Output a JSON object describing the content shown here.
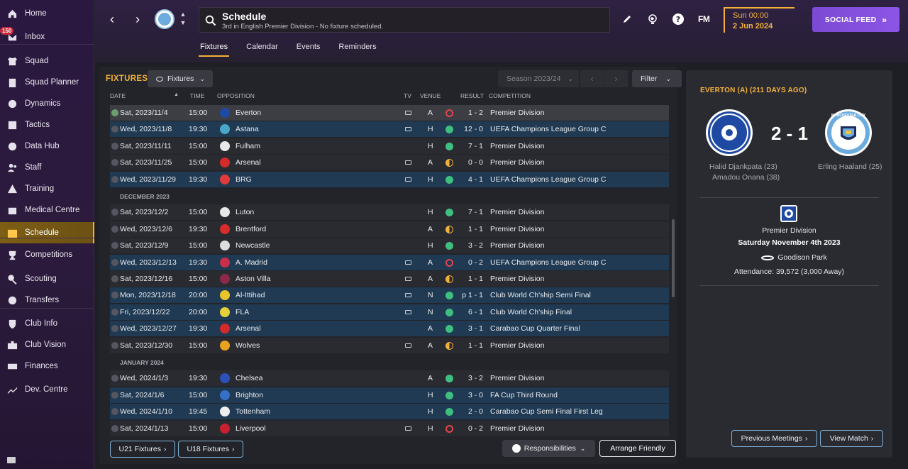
{
  "sidebar": {
    "inbox_badge": "150",
    "items": [
      {
        "label": "Home",
        "icon": "home-icon"
      },
      {
        "label": "Inbox",
        "icon": "inbox-icon"
      },
      {
        "label": "Squad",
        "icon": "shirt-icon"
      },
      {
        "label": "Squad Planner",
        "icon": "clipboard-icon"
      },
      {
        "label": "Dynamics",
        "icon": "dynamics-icon"
      },
      {
        "label": "Tactics",
        "icon": "tactics-icon"
      },
      {
        "label": "Data Hub",
        "icon": "data-hub-icon"
      },
      {
        "label": "Staff",
        "icon": "staff-icon"
      },
      {
        "label": "Training",
        "icon": "training-icon"
      },
      {
        "label": "Medical Centre",
        "icon": "medical-icon"
      },
      {
        "label": "Schedule",
        "icon": "calendar-icon"
      },
      {
        "label": "Competitions",
        "icon": "trophy-icon"
      },
      {
        "label": "Scouting",
        "icon": "magnifier-icon"
      },
      {
        "label": "Transfers",
        "icon": "transfer-icon"
      },
      {
        "label": "Club Info",
        "icon": "shield-icon"
      },
      {
        "label": "Club Vision",
        "icon": "briefcase-icon"
      },
      {
        "label": "Finances",
        "icon": "money-icon"
      },
      {
        "label": "Dev. Centre",
        "icon": "growth-icon"
      }
    ]
  },
  "header": {
    "title": "Schedule",
    "subtitle": "3rd in English Premier Division - No fixture scheduled.",
    "fm_logo": "FM",
    "date_time": "Sun 00:00",
    "date": "2 Jun 2024",
    "social_feed": "SOCIAL FEED",
    "tabs": [
      "Fixtures",
      "Calendar",
      "Events",
      "Reminders"
    ]
  },
  "fixtures": {
    "title": "FIXTURES",
    "view_dropdown": "Fixtures",
    "season": "Season 2023/24",
    "filter": "Filter",
    "columns": {
      "date": "DATE",
      "time": "TIME",
      "opposition": "OPPOSITION",
      "tv": "TV",
      "venue": "VENUE",
      "result": "RESULT",
      "competition": "COMPETITION"
    },
    "rows": [
      {
        "type": "row",
        "date": "Sat, 2023/11/4",
        "time": "15:00",
        "opp": "Everton",
        "tv": true,
        "venue": "A",
        "res": "l",
        "score": "1 - 2",
        "comp": "Premier Division",
        "style": "sel",
        "crest": "#1f4aa3",
        "done": true
      },
      {
        "type": "row",
        "date": "Wed, 2023/11/8",
        "time": "19:30",
        "opp": "Astana",
        "tv": true,
        "venue": "H",
        "res": "w",
        "score": "12 - 0",
        "comp": "UEFA Champions League Group C",
        "style": "b",
        "crest": "#4aa6c8"
      },
      {
        "type": "row",
        "date": "Sat, 2023/11/11",
        "time": "15:00",
        "opp": "Fulham",
        "tv": false,
        "venue": "H",
        "res": "w",
        "score": "7 - 1",
        "comp": "Premier Division",
        "style": "a",
        "crest": "#e8e8e8"
      },
      {
        "type": "row",
        "date": "Sat, 2023/11/25",
        "time": "15:00",
        "opp": "Arsenal",
        "tv": true,
        "venue": "A",
        "res": "d",
        "score": "0 - 0",
        "comp": "Premier Division",
        "style": "a",
        "crest": "#d42a2a"
      },
      {
        "type": "row",
        "date": "Wed, 2023/11/29",
        "time": "19:30",
        "opp": "BRG",
        "tv": true,
        "venue": "H",
        "res": "w",
        "score": "4 - 1",
        "comp": "UEFA Champions League Group C",
        "style": "b",
        "crest": "#e03a3a"
      },
      {
        "type": "month",
        "label": "DECEMBER 2023"
      },
      {
        "type": "row",
        "date": "Sat, 2023/12/2",
        "time": "15:00",
        "opp": "Luton",
        "tv": false,
        "venue": "H",
        "res": "w",
        "score": "7 - 1",
        "comp": "Premier Division",
        "style": "a",
        "crest": "#e8e8e8"
      },
      {
        "type": "row",
        "date": "Wed, 2023/12/6",
        "time": "19:30",
        "opp": "Brentford",
        "tv": false,
        "venue": "A",
        "res": "d",
        "score": "1 - 1",
        "comp": "Premier Division",
        "style": "a",
        "crest": "#d82b2b"
      },
      {
        "type": "row",
        "date": "Sat, 2023/12/9",
        "time": "15:00",
        "opp": "Newcastle",
        "tv": false,
        "venue": "H",
        "res": "w",
        "score": "3 - 2",
        "comp": "Premier Division",
        "style": "a",
        "crest": "#dddddd"
      },
      {
        "type": "row",
        "date": "Wed, 2023/12/13",
        "time": "19:30",
        "opp": "A. Madrid",
        "tv": true,
        "venue": "A",
        "res": "l",
        "score": "0 - 2",
        "comp": "UEFA Champions League Group C",
        "style": "b",
        "crest": "#c8304a"
      },
      {
        "type": "row",
        "date": "Sat, 2023/12/16",
        "time": "15:00",
        "opp": "Aston Villa",
        "tv": true,
        "venue": "A",
        "res": "d",
        "score": "1 - 1",
        "comp": "Premier Division",
        "style": "a",
        "crest": "#8a2a48"
      },
      {
        "type": "row",
        "date": "Mon, 2023/12/18",
        "time": "20:00",
        "opp": "Al-Ittihad",
        "tv": true,
        "venue": "N",
        "res": "w",
        "score": "p 1 - 1",
        "comp": "Club World Ch'ship Semi Final",
        "style": "b",
        "crest": "#e8c52c"
      },
      {
        "type": "row",
        "date": "Fri, 2023/12/22",
        "time": "20:00",
        "opp": "FLA",
        "tv": true,
        "venue": "N",
        "res": "w",
        "score": "6 - 1",
        "comp": "Club World Ch'ship Final",
        "style": "b",
        "crest": "#e3cf3a"
      },
      {
        "type": "row",
        "date": "Wed, 2023/12/27",
        "time": "19:30",
        "opp": "Arsenal",
        "tv": false,
        "venue": "A",
        "res": "w",
        "score": "3 - 1",
        "comp": "Carabao Cup Quarter Final",
        "style": "b",
        "crest": "#d42a2a"
      },
      {
        "type": "row",
        "date": "Sat, 2023/12/30",
        "time": "15:00",
        "opp": "Wolves",
        "tv": true,
        "venue": "A",
        "res": "d",
        "score": "1 - 1",
        "comp": "Premier Division",
        "style": "a",
        "crest": "#e7a21f"
      },
      {
        "type": "month",
        "label": "JANUARY 2024"
      },
      {
        "type": "row",
        "date": "Wed, 2024/1/3",
        "time": "19:30",
        "opp": "Chelsea",
        "tv": false,
        "venue": "A",
        "res": "w",
        "score": "3 - 2",
        "comp": "Premier Division",
        "style": "a",
        "crest": "#2b52b8"
      },
      {
        "type": "row",
        "date": "Sat, 2024/1/6",
        "time": "15:00",
        "opp": "Brighton",
        "tv": false,
        "venue": "H",
        "res": "w",
        "score": "3 - 0",
        "comp": "FA Cup Third Round",
        "style": "b",
        "crest": "#3570c8"
      },
      {
        "type": "row",
        "date": "Wed, 2024/1/10",
        "time": "19:45",
        "opp": "Tottenham",
        "tv": false,
        "venue": "H",
        "res": "w",
        "score": "2 - 0",
        "comp": "Carabao Cup Semi Final First Leg",
        "style": "b",
        "crest": "#eeeeee"
      },
      {
        "type": "row",
        "date": "Sat, 2024/1/13",
        "time": "15:00",
        "opp": "Liverpool",
        "tv": true,
        "venue": "H",
        "res": "l",
        "score": "0 - 2",
        "comp": "Premier Division",
        "style": "a",
        "crest": "#c8202e"
      }
    ],
    "buttons": {
      "u21": "U21 Fixtures",
      "u18": "U18 Fixtures",
      "responsibilities": "Responsibilities",
      "arrange": "Arrange Friendly"
    }
  },
  "match": {
    "title": "EVERTON (A) (211 DAYS AGO)",
    "score": "2 - 1",
    "home_scorers": [
      "Halid Djankpata (23)",
      "Amadou Onana (38)"
    ],
    "away_scorers": [
      "Erling Haaland (25)"
    ],
    "away_crest_text": "MANCHESTER CITY",
    "competition": "Premier Division",
    "date": "Saturday November 4th 2023",
    "stadium": "Goodison Park",
    "attendance": "Attendance: 39,572 (3,000 Away)",
    "previous_meetings": "Previous Meetings",
    "view_match": "View Match"
  },
  "colors": {
    "accent": "#f3b13a",
    "win": "#3fbf7f",
    "loss": "#e2454e",
    "social": "#8d55e6",
    "link_border": "#7fb2d9"
  }
}
